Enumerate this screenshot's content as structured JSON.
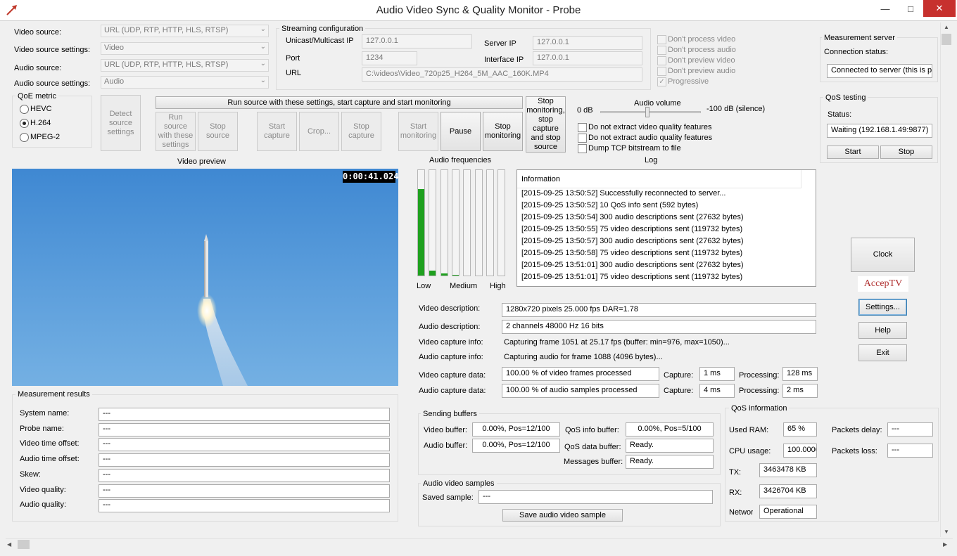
{
  "app": {
    "title": "Audio Video Sync & Quality Monitor - Probe"
  },
  "source": {
    "video_source_label": "Video source:",
    "video_source_value": "URL (UDP, RTP, HTTP, HLS, RTSP)",
    "video_settings_label": "Video source settings:",
    "video_settings_value": "Video",
    "audio_source_label": "Audio source:",
    "audio_source_value": "URL (UDP, RTP, HTTP, HLS, RTSP)",
    "audio_settings_label": "Audio source settings:",
    "audio_settings_value": "Audio"
  },
  "qoe": {
    "title": "QoE metric",
    "options": [
      {
        "label": "HEVC",
        "selected": false
      },
      {
        "label": "H.264",
        "selected": true
      },
      {
        "label": "MPEG-2",
        "selected": false
      }
    ]
  },
  "streaming": {
    "title": "Streaming configuration",
    "unicast_label": "Unicast/Multicast IP",
    "unicast_value": "127.0.0.1",
    "port_label": "Port",
    "port_value": "1234",
    "url_label": "URL",
    "url_value": "C:\\videos\\Video_720p25_H264_5M_AAC_160K.MP4",
    "server_ip_label": "Server IP",
    "server_ip_value": "127.0.0.1",
    "interface_ip_label": "Interface IP",
    "interface_ip_value": "127.0.0.1"
  },
  "options": [
    "Don't process video",
    "Don't process audio",
    "Don't preview video",
    "Don't preview audio",
    "Progressive"
  ],
  "options_checked": [
    false,
    false,
    false,
    false,
    true
  ],
  "measurement_server": {
    "title": "Measurement server",
    "status_label": "Connection status:",
    "status_value": "Connected to server (this is p"
  },
  "qos_testing": {
    "title": "QoS testing",
    "status_label": "Status:",
    "status_value": "Waiting (192.168.1.49:9877)",
    "start": "Start",
    "stop": "Stop"
  },
  "controls": {
    "run_all": "Run source with these settings, start capture and start monitoring",
    "detect": "Detect source settings",
    "run_source": "Run source with these settings",
    "stop_source": "Stop source",
    "start_capture": "Start capture",
    "crop": "Crop...",
    "stop_capture": "Stop capture",
    "start_monitoring": "Start monitoring",
    "pause": "Pause",
    "stop_monitoring": "Stop monitoring",
    "stop_all": "Stop monitoring, stop capture and stop source"
  },
  "audio_volume": {
    "label": "Audio volume",
    "min_label": "0 dB",
    "max_label": "-100 dB (silence)",
    "level": 0.47
  },
  "extract": [
    "Do not extract video quality features",
    "Do not extract audio quality features",
    "Dump TCP bitstream to file"
  ],
  "video_preview": {
    "label": "Video preview",
    "timecode": "0:00:41.024"
  },
  "audio_freq": {
    "label": "Audio frequencies",
    "low": "Low",
    "medium": "Medium",
    "high": "High",
    "levels": [
      0.82,
      0.05,
      0.02,
      0.01,
      0,
      0,
      0,
      0
    ]
  },
  "log": {
    "label": "Log",
    "header": "Information",
    "entries": [
      "[2015-09-25 13:50:52] Successfully reconnected to server...",
      "[2015-09-25 13:50:52] 10 QoS info sent (592 bytes)",
      "[2015-09-25 13:50:54] 300 audio descriptions sent (27632 bytes)",
      "[2015-09-25 13:50:55] 75 video descriptions sent (119732 bytes)",
      "[2015-09-25 13:50:57] 300 audio descriptions sent (27632 bytes)",
      "[2015-09-25 13:50:58] 75 video descriptions sent (119732 bytes)",
      "[2015-09-25 13:51:01] 300 audio descriptions sent (27632 bytes)",
      "[2015-09-25 13:51:01] 75 video descriptions sent (119732 bytes)"
    ]
  },
  "side": {
    "clock": "Clock",
    "brand": "AccepTV",
    "settings": "Settings...",
    "help": "Help",
    "exit": "Exit"
  },
  "info": {
    "video_desc_label": "Video description:",
    "video_desc_value": "1280x720 pixels 25.000 fps DAR=1.78",
    "audio_desc_label": "Audio description:",
    "audio_desc_value": "2 channels 48000 Hz 16 bits",
    "video_cap_info_label": "Video capture info:",
    "video_cap_info_value": "Capturing frame 1051 at 25.17 fps (buffer: min=976, max=1050)...",
    "audio_cap_info_label": "Audio capture info:",
    "audio_cap_info_value": "Capturing audio for frame 1088 (4096 bytes)...",
    "video_cap_data_label": "Video capture data:",
    "video_cap_data_value": "100.00 % of video frames processed",
    "audio_cap_data_label": "Audio capture data:",
    "audio_cap_data_value": "100.00 % of audio samples processed",
    "capture_label": "Capture:",
    "processing_label": "Processing:",
    "video_capture": "1 ms",
    "video_processing": "128 ms",
    "audio_capture": "4 ms",
    "audio_processing": "2 ms"
  },
  "measurement": {
    "title": "Measurement results",
    "rows": [
      {
        "label": "System name:",
        "value": "---"
      },
      {
        "label": "Probe name:",
        "value": "---"
      },
      {
        "label": "Video time offset:",
        "value": "---"
      },
      {
        "label": "Audio time offset:",
        "value": "---"
      },
      {
        "label": "Skew:",
        "value": "---"
      },
      {
        "label": "Video quality:",
        "value": "---"
      },
      {
        "label": "Audio quality:",
        "value": "---"
      }
    ]
  },
  "buffers": {
    "title": "Sending buffers",
    "video_label": "Video buffer:",
    "video_value": "0.00%, Pos=12/100",
    "audio_label": "Audio buffer:",
    "audio_value": "0.00%, Pos=12/100",
    "qos_info_label": "QoS info buffer:",
    "qos_info_value": "0.00%, Pos=5/100",
    "qos_data_label": "QoS data buffer:",
    "qos_data_value": "Ready.",
    "messages_label": "Messages buffer:",
    "messages_value": "Ready."
  },
  "samples": {
    "title": "Audio video samples",
    "saved_label": "Saved sample:",
    "saved_value": "---",
    "save_button": "Save audio video sample"
  },
  "qos_info": {
    "title": "QoS information",
    "ram_label": "Used RAM:",
    "ram_value": "65 %",
    "cpu_label": "CPU usage:",
    "cpu_value": "100.0000",
    "tx_label": "TX:",
    "tx_value": "3463478 KB",
    "rx_label": "RX:",
    "rx_value": "3426704 KB",
    "network_label": "Networ",
    "network_value": "Operational",
    "delay_label": "Packets delay:",
    "delay_value": "---",
    "loss_label": "Packets loss:",
    "loss_value": "---"
  }
}
